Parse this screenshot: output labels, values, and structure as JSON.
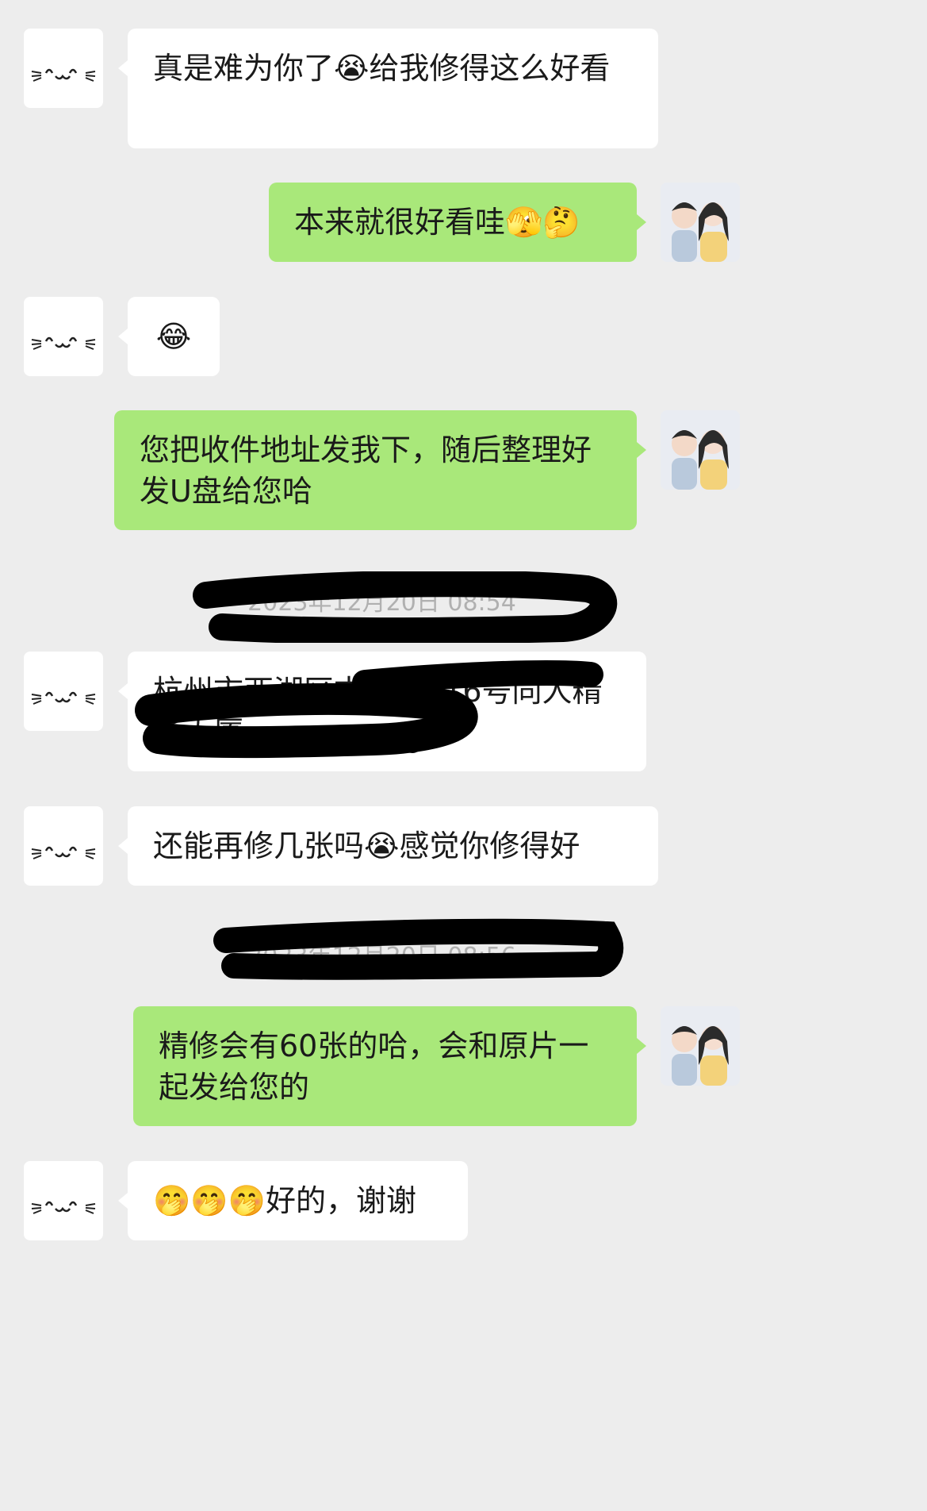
{
  "messages": [
    {
      "side": "left",
      "text": "真是难为你了😭给我修得这么好看"
    },
    {
      "side": "right",
      "text": "本来就很好看哇🫣🤔"
    },
    {
      "side": "left",
      "text": "😂"
    },
    {
      "side": "right",
      "text": "您把收件地址发我下，随后整理好发U盘给您哈"
    },
    {
      "side": "left",
      "text": "杭州市西湖区古墩路616号同人精华大厦"
    },
    {
      "side": "left",
      "text": "还能再修几张吗😭感觉你修得好"
    },
    {
      "side": "right",
      "text": "精修会有60张的哈，会和原片一起发给您的"
    },
    {
      "side": "left",
      "text": "🤭🤭🤭好的，谢谢"
    }
  ],
  "timestamps": [
    "2023年12月20日 08:54",
    "2023年12月20日 08:56"
  ],
  "colors": {
    "background": "#ededed",
    "self_bubble": "#a9e87a",
    "other_bubble": "#ffffff",
    "redaction": "#000000"
  },
  "icons": {
    "other_avatar": "cat-face-icon",
    "self_avatar": "couple-portrait-icon"
  }
}
